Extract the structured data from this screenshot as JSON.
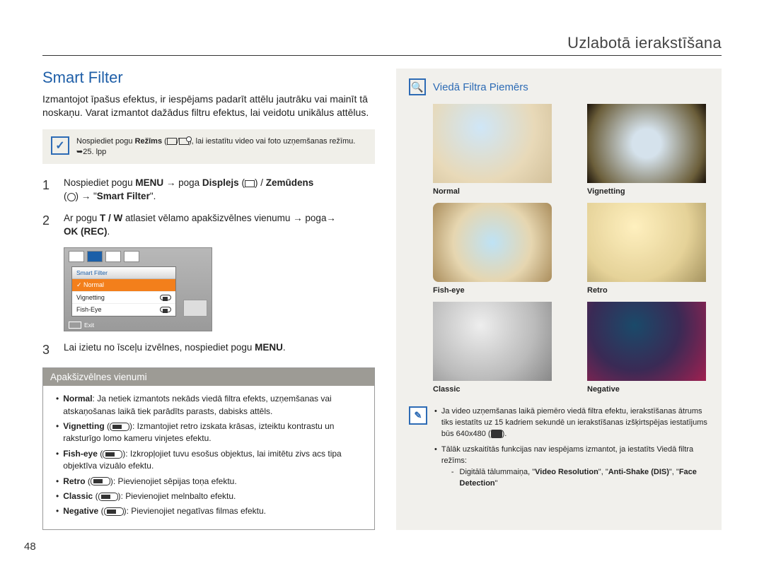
{
  "header": {
    "title": "Uzlabotā ierakstīšana"
  },
  "pagenum": "48",
  "left": {
    "title": "Smart Filter",
    "intro": "Izmantojot īpašus efektus, ir iespējams padarīt attēlu jautrāku vai mainīt tā noskaņu. Varat izmantot dažādus filtru efektus, lai veidotu unikālus attēlus.",
    "note_pre": "Nospiediet pogu ",
    "note_mode": "Režīms",
    "note_post": ", lai iestatītu video vai foto uzņemšanas režīmu. ➥25. lpp",
    "step1_a": "Nospiediet pogu ",
    "step1_menu": "MENU",
    "step1_b": " poga ",
    "step1_disp": "Displejs",
    "step1_c": " / ",
    "step1_zem": "Zemūdens",
    "step1_d": " → \"",
    "step1_sf": "Smart Filter",
    "step1_e": "\".",
    "step2_a": "Ar pogu ",
    "step2_tw": "T / W",
    "step2_b": " atlasiet vēlamo apakšizvēlnes vienumu → poga ",
    "step2_ok": "OK (REC)",
    "step2_c": ".",
    "step3_a": "Lai izietu no īsceļu izvēlnes, nospiediet pogu ",
    "step3_menu": "MENU",
    "step3_b": ".",
    "cam": {
      "head": "Smart Filter",
      "row_normal": "Normal",
      "row_vig": "Vignetting",
      "row_fish": "Fish-Eye",
      "exit": "Exit"
    },
    "submenu": {
      "header": "Apakšizvēlnes vienumi",
      "normal_t": "Normal",
      "normal_d": ": Ja netiek izmantots nekāds viedā filtra efekts, uzņemšanas vai atskaņošanas laikā tiek parādīts parasts, dabisks attēls.",
      "vig_t": "Vignetting",
      "vig_d": ": Izmantojiet retro izskata krāsas, izteiktu kontrastu un raksturīgo lomo kameru vinjetes efektu.",
      "fish_t": "Fish-eye",
      "fish_d": ": Izkropļojiet tuvu esošus objektus, lai imitētu zivs acs tipa objektīva vizuālo efektu.",
      "retro_t": "Retro",
      "retro_d": ": Pievienojiet sēpijas toņa efektu.",
      "classic_t": "Classic",
      "classic_d": ": Pievienojiet melnbalto efektu.",
      "neg_t": "Negative",
      "neg_d": ": Pievienojiet negatīvas filmas efektu."
    }
  },
  "right": {
    "title": "Viedā Filtra Piemērs",
    "labels": {
      "normal": "Normal",
      "vignetting": "Vignetting",
      "fisheye": "Fish-eye",
      "retro": "Retro",
      "classic": "Classic",
      "negative": "Negative"
    },
    "note1": "Ja video uzņemšanas laikā piemēro viedā filtra efektu, ierakstīšanas ātrums tiks iestatīts uz 15 kadriem sekundē un ierakstīšanas izšķirtspējas iestatījums būs 640x480 (",
    "note1b": ").",
    "note2": "Tālāk uzskaitītās funkcijas nav iespējams izmantot, ja iestatīts Viedā filtra režīms:",
    "note3_a": "Digitālā tālummaiņa, \"",
    "note3_vr": "Video Resolution",
    "note3_b": "\", \"",
    "note3_as": "Anti-Shake (DIS)",
    "note3_c": "\", \"",
    "note3_fd": "Face Detection",
    "note3_d": "\""
  }
}
